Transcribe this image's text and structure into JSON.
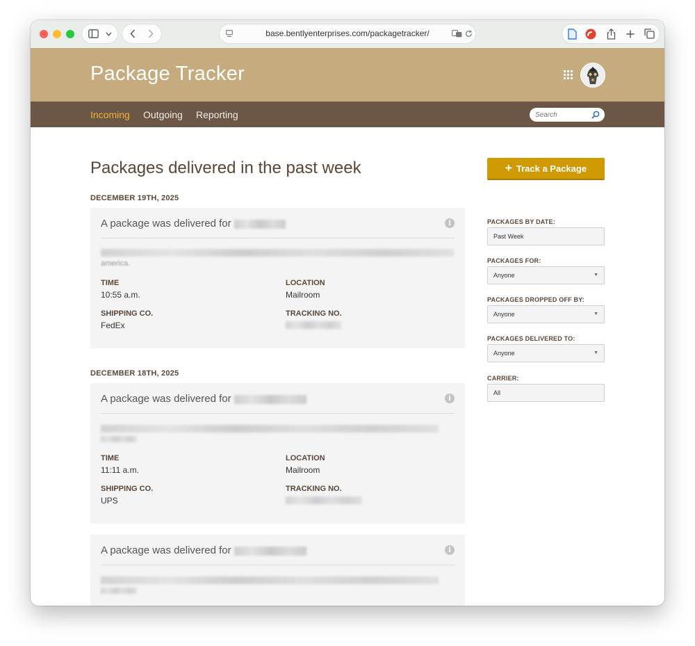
{
  "browser": {
    "url": "base.bentlyenterprises.com/packagetracker/"
  },
  "header": {
    "title": "Package Tracker"
  },
  "nav": {
    "items": [
      "Incoming",
      "Outgoing",
      "Reporting"
    ],
    "active": "Incoming",
    "search_placeholder": "Search"
  },
  "main": {
    "heading": "Packages delivered in the past week",
    "groups": [
      {
        "date": "DECEMBER 19TH, 2025",
        "card": {
          "title": "A package was delivered for",
          "desc_tail": "america.",
          "time_label": "TIME",
          "time": "10:55 a.m.",
          "location_label": "LOCATION",
          "location": "Mailroom",
          "shipping_label": "SHIPPING CO.",
          "shipping": "FedEx",
          "tracking_label": "TRACKING NO."
        }
      },
      {
        "date": "DECEMBER 18TH, 2025",
        "card": {
          "title": "A package was delivered for",
          "time_label": "TIME",
          "time": "11:11 a.m.",
          "location_label": "LOCATION",
          "location": "Mailroom",
          "shipping_label": "SHIPPING CO.",
          "shipping": "UPS",
          "tracking_label": "TRACKING NO."
        }
      },
      {
        "card": {
          "title": "A package was delivered for"
        }
      }
    ]
  },
  "sidebar": {
    "track_button": "Track a Package",
    "filters": [
      {
        "label": "PACKAGES BY DATE:",
        "value": "Past Week",
        "type": "text"
      },
      {
        "label": "PACKAGES FOR:",
        "value": "Anyone",
        "type": "select"
      },
      {
        "label": "PACKAGES DROPPED OFF BY:",
        "value": "Anyone",
        "type": "select"
      },
      {
        "label": "PACKAGES DELIVERED TO:",
        "value": "Anyone",
        "type": "select"
      },
      {
        "label": "CARRIER:",
        "value": "All",
        "type": "text"
      }
    ]
  },
  "colors": {
    "header_bg": "#c6ab7f",
    "nav_bg": "#6c5646",
    "nav_active": "#f2b13b",
    "button_bg": "#d09a05",
    "heading_text": "#5b4636"
  }
}
